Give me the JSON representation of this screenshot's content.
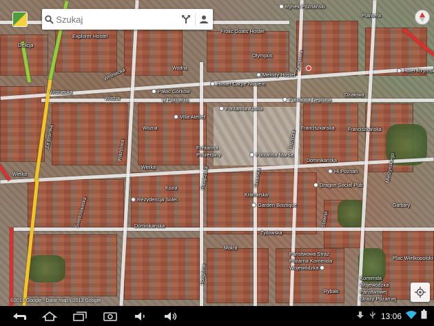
{
  "search": {
    "placeholder": "Szukaj"
  },
  "map": {
    "copyright": "©2013 Google - Dane map ©2013 Google",
    "labels": {
      "rynek_poznanski": "Rynek Poznański",
      "plantera": "Plantera",
      "explorer_hostel": "Explorer Hostel",
      "frolic_goats_hostel": "Frolic Goats Hostel",
      "olympus": "Olympus",
      "delicja": "Delicja",
      "melody_hostel": "Melody Hostel",
      "hotel_rzymski": "Hotel Rzymski",
      "hostel_carpe_noctem": "Hostel Carpe Noctem",
      "palac_gorkow": "Pałac Górków",
      "w_poznaniu": "w Poznaniu",
      "fontanna_apolla": "Fontanna Apolla",
      "fontanna_neptuna": "Fontanna Neptuna",
      "villa_atelier": "Villa Atelier",
      "franciszkanska_1": "Franciszkańska",
      "franciszkanska_2": "Franciszkańska",
      "fontanna_prozerpiny_1": "Fontanna",
      "fontanna_prozerpiny_2": "Prozerpiny",
      "fontanna_marsa": "Fontanna Marsa",
      "hi_poznan": "Hi Poznań",
      "dragon_social_pub": "Dragon Social Pub",
      "rezydencja_solei": "Rezydencja Solei",
      "garden_boutique": "Garden Boutique",
      "kramarska": "Kramarska",
      "dominikanska": "Dominikańska",
      "mokra": "Mokra",
      "panstwowa_straz_1": "Państwowa Straż",
      "panstwowa_straz_2": "Pożarna Komenda",
      "panstwowa_straz_3": "Wojewódzka",
      "plac_wielkopolski": "Plac Wielkopolski",
      "komenda_1": "Komenda",
      "komenda_2": "Wojewódzka",
      "komenda_3": "Państwowej",
      "komenda_4": "Straży Pożarnej",
      "ul_wozna": "Wożna",
      "ul_wodna": "Wodna",
      "ul_wroniecka": "Wroniecka",
      "ul_wielka": "Wielka",
      "ul_wielka_2": "Wielka",
      "ul_ratajczaka": "Ratajczaka",
      "ul_wroniecka_2": "Wroniecka",
      "ul_szewska": "Szewska",
      "ul_dzialowa": "Działowa",
      "ul_garbary": "Garbary",
      "ul_za_bramka": "Za Bramką",
      "ul_podgorna": "Podgórna",
      "ul_wjazdowa": "Wjazdowa",
      "ul_zamkowa": "Zamkowa",
      "ul_mielzynskiego": "Mielżyńskiego",
      "ul_stawna": "Stawna",
      "ul_wodna_2": "Wodna",
      "ul_swietoslawska": "Świętosławska",
      "ul_dominikanska_2": "Dominikańska",
      "ul_kozia": "Kozia",
      "ul_zydowska": "Żydowska",
      "ul_bozej": "Bożnicza",
      "ul_rybaki": "Rybaki"
    }
  },
  "statusbar": {
    "time": "13:06"
  }
}
